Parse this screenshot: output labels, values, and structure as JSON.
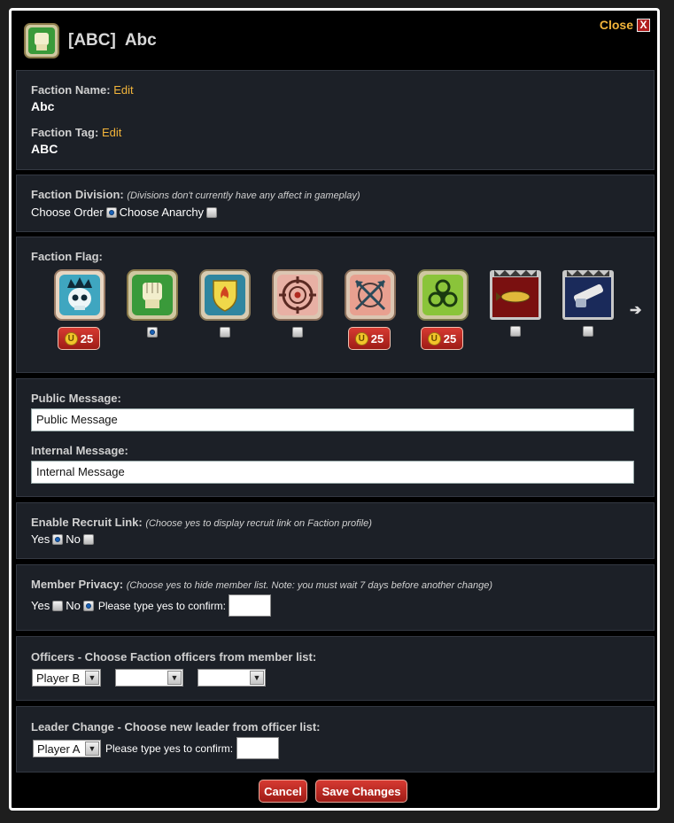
{
  "window": {
    "close_label": "Close",
    "close_glyph": "X",
    "tag": "[ABC]",
    "name": "Abc"
  },
  "identity": {
    "faction_name_label": "Faction Name:",
    "faction_name_edit": "Edit",
    "faction_name_value": "Abc",
    "faction_tag_label": "Faction Tag:",
    "faction_tag_edit": "Edit",
    "faction_tag_value": "ABC"
  },
  "division": {
    "label": "Faction Division:",
    "note": "(Divisions don't currently have any affect in gameplay)",
    "order_label": "Choose Order",
    "anarchy_label": "Choose Anarchy",
    "selected": "order"
  },
  "flags": {
    "label": "Faction Flag:",
    "items": [
      {
        "icon": "skull-crown-flag-icon",
        "price": "25",
        "selected": false
      },
      {
        "icon": "fist-flag-icon",
        "price": "",
        "selected": true
      },
      {
        "icon": "flame-shield-flag-icon",
        "price": "",
        "selected": false
      },
      {
        "icon": "target-flag-icon",
        "price": "",
        "selected": false
      },
      {
        "icon": "crossed-arrows-flag-icon",
        "price": "25",
        "selected": false
      },
      {
        "icon": "biohazard-flag-icon",
        "price": "25",
        "selected": false
      },
      {
        "icon": "missile-flag-icon",
        "price": "",
        "selected": false
      },
      {
        "icon": "chainsaw-flag-icon",
        "price": "",
        "selected": false
      }
    ],
    "currency_glyph": "U",
    "next_glyph": "➔"
  },
  "messages": {
    "public_label": "Public Message:",
    "public_value": "Public Message",
    "internal_label": "Internal Message:",
    "internal_value": "Internal Message"
  },
  "recruit": {
    "label": "Enable Recruit Link:",
    "note": "(Choose yes to display recruit link on Faction profile)",
    "yes_label": "Yes",
    "no_label": "No",
    "selected": "yes"
  },
  "privacy": {
    "label": "Member Privacy:",
    "note": "(Choose yes to hide member list. Note: you must wait 7 days before another change)",
    "yes_label": "Yes",
    "no_label": "No",
    "selected": "no",
    "confirm_label": "Please type yes to confirm:",
    "confirm_value": ""
  },
  "officers": {
    "label": "Officers - Choose Faction officers from member list:",
    "select_1": "Player B",
    "select_2": "",
    "select_3": ""
  },
  "leader": {
    "label": "Leader Change - Choose new leader from officer list:",
    "select": "Player A",
    "confirm_label": "Please type yes to confirm:",
    "confirm_value": ""
  },
  "actions": {
    "cancel_label": "Cancel",
    "save_label": "Save Changes"
  },
  "colors": {
    "accent": "#f2b43a",
    "panel": "#1c2027",
    "button": "#c02a22"
  }
}
